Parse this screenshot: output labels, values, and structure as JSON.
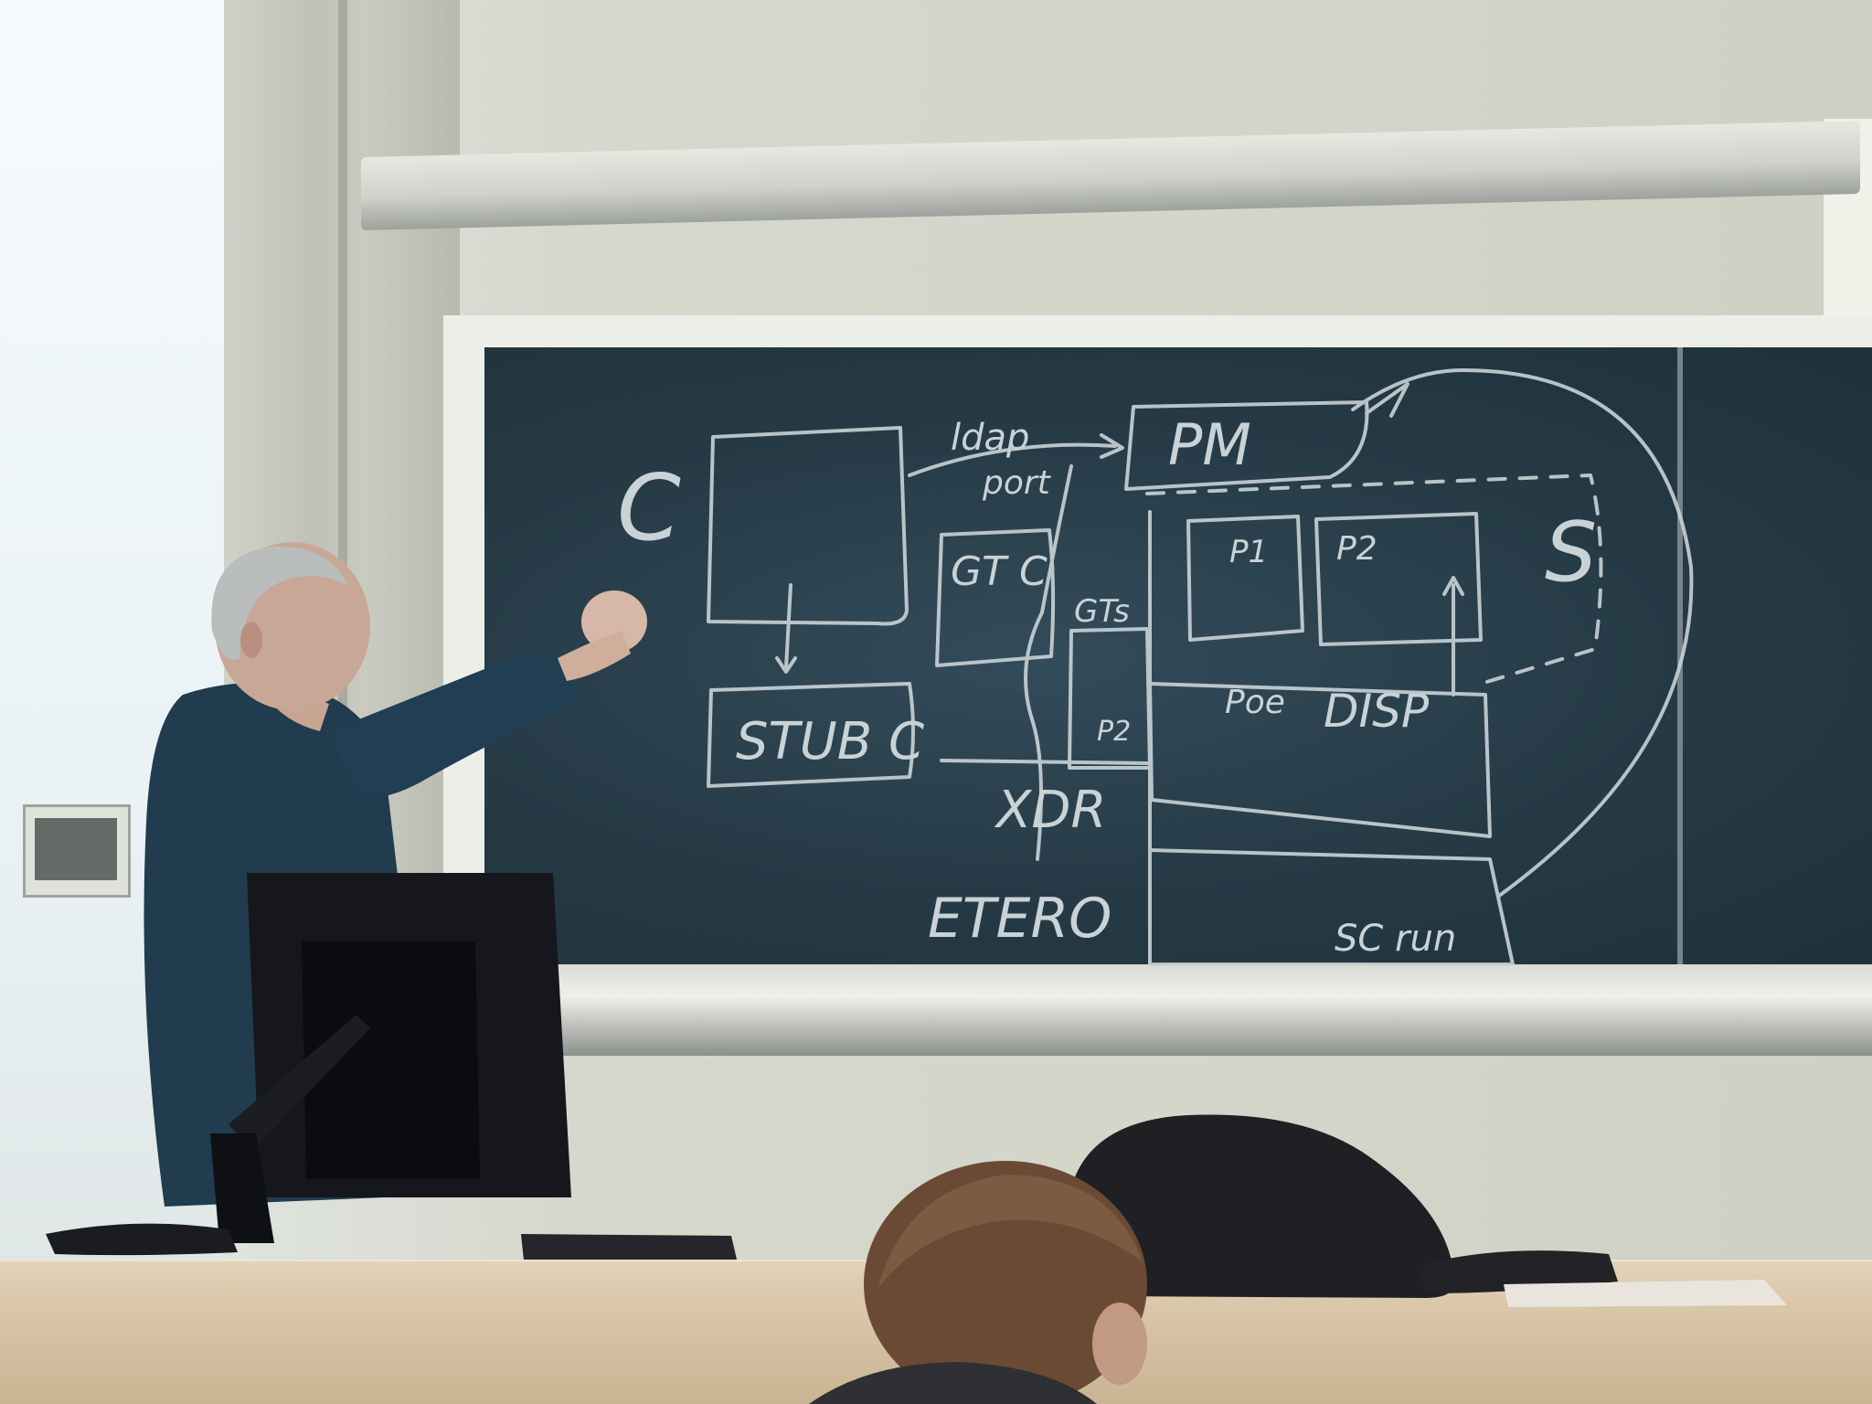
{
  "scene": {
    "kind": "classroom-lecture-photo",
    "colors": {
      "chalkboard": "#253a45",
      "chalk": "#c9d3d6",
      "wall": "#d4d5c9",
      "jacket": "#203c4e",
      "desk": "#dcc8ab",
      "monitor": "#15171c"
    }
  },
  "blackboard": {
    "labels": {
      "c": "C",
      "pm": "PM",
      "ldap": "ldap",
      "port": "port",
      "gt_c": "GT C",
      "gt_s": "GTs",
      "stub_c": "STUB C",
      "p1": "P1",
      "p2": "P2",
      "p2_small": "P2",
      "s": "S",
      "poe": "Poe",
      "disp": "DISP",
      "xdr": "XDR",
      "etero": "ETERO",
      "sc_run": "SC run"
    }
  },
  "icons": {
    "person": "lecturer-figure",
    "monitor": "computer-monitor",
    "bag": "backpack",
    "student": "student-head"
  }
}
